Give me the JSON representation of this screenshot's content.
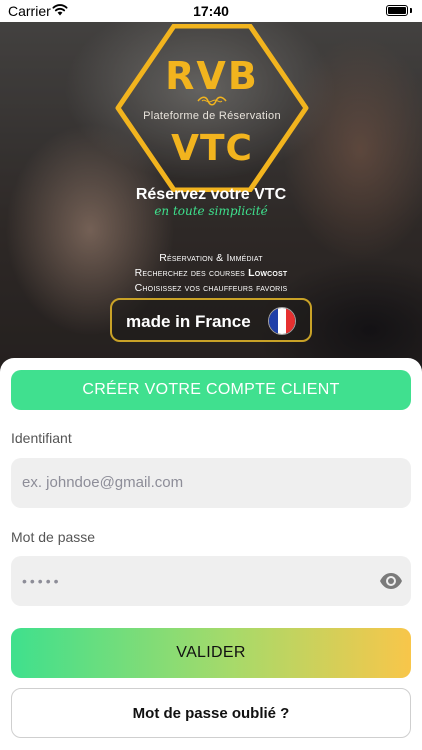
{
  "status_bar": {
    "carrier": "Carrier",
    "time": "17:40"
  },
  "hero": {
    "brand_top": "RVB",
    "brand_subtitle": "Plateforme de Réservation",
    "brand_bottom": "VTC",
    "tagline": "Réservez votre VTC",
    "tagline_sub": "en toute simplicité",
    "features": [
      {
        "text": "Réservation & Immédiat",
        "bold": ""
      },
      {
        "text": "Recherchez des courses ",
        "bold": "Lowcost"
      },
      {
        "text": "Choisissez vos chauffeurs favoris",
        "bold": ""
      }
    ],
    "badge_text": "made in France",
    "colors": {
      "gold": "#f2b41e",
      "badge_border": "#c9a227",
      "tagline_green": "#3ee08c"
    }
  },
  "form": {
    "create_account_label": "CRÉER VOTRE COMPTE CLIENT",
    "username_label": "Identifiant",
    "username_placeholder": "ex. johndoe@gmail.com",
    "password_label": "Mot de passe",
    "password_masked": "•••••",
    "submit_label": "VALIDER",
    "forgot_label": "Mot de passe oublié ?",
    "colors": {
      "primary_green": "#40e08f",
      "gradient_start": "#3fe08d",
      "gradient_end": "#f8c64a"
    }
  },
  "icons": {
    "wifi": "wifi-icon",
    "battery": "battery-icon",
    "eye": "eye-icon",
    "flag": "france-flag-icon"
  }
}
